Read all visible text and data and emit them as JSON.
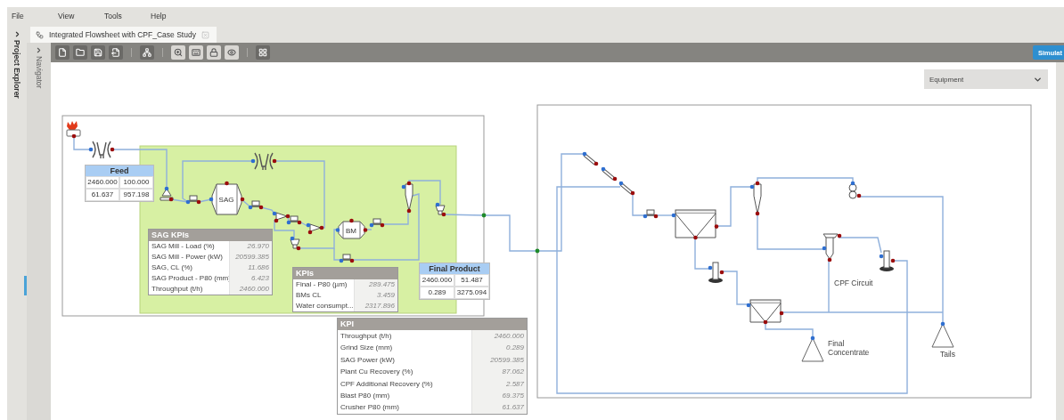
{
  "menu": [
    {
      "label": "File"
    },
    {
      "label": "View"
    },
    {
      "label": "Tools"
    },
    {
      "label": "Help"
    }
  ],
  "sidebar": {
    "label": "Project Explorer"
  },
  "tabs": [
    {
      "label": "Integrated Flowsheet with CPF_Case Study",
      "selected": true
    }
  ],
  "navigator": {
    "label": "Navigator"
  },
  "simulate_button": {
    "label": "Simulat"
  },
  "equipment_dropdown": {
    "value": "Equipment"
  },
  "diagram": {
    "mill_labels": [
      "SAG",
      "BM"
    ],
    "labels": [
      "CPF Circuit",
      "Final Concentrate",
      "Tails"
    ]
  },
  "feed_table": {
    "title": "Feed",
    "rows": [
      [
        "2460.000",
        "100.000"
      ],
      [
        "61.637",
        "957.198"
      ]
    ]
  },
  "sag_kpis": {
    "title": "SAG KPIs",
    "rows": [
      {
        "label": "SAG Mill - Load (%)",
        "value": "26.970"
      },
      {
        "label": "SAG Mill - Power (kW)",
        "value": "20599.385"
      },
      {
        "label": "SAG, CL (%)",
        "value": "11.686"
      },
      {
        "label": "SAG Product - P80 (mm)",
        "value": "6.423"
      },
      {
        "label": "Throughput (t/h)",
        "value": "2460.000"
      }
    ]
  },
  "kpis": {
    "title": "KPIs",
    "rows": [
      {
        "label": "Final - P80 (µm)",
        "value": "289.475"
      },
      {
        "label": "BMs CL",
        "value": "3.459"
      },
      {
        "label": "Water consumpt...",
        "value": "2317.896"
      }
    ]
  },
  "final_product_table": {
    "title": "Final Product",
    "rows": [
      [
        "2460.000",
        "51.487"
      ],
      [
        "0.289",
        "3275.094"
      ]
    ]
  },
  "kpi": {
    "title": "KPI",
    "rows": [
      {
        "label": "Throughput (t/h)",
        "value": "2460.000"
      },
      {
        "label": "Grind Size (mm)",
        "value": "0.289"
      },
      {
        "label": "SAG Power (kW)",
        "value": "20599.385"
      },
      {
        "label": "Plant Cu Recovery (%)",
        "value": "87.062"
      },
      {
        "label": "CPF Additional Recovery (%)",
        "value": "2.587"
      },
      {
        "label": "Blast P80 (mm)",
        "value": "69.375"
      },
      {
        "label": "Crusher P80 (mm)",
        "value": "61.637"
      }
    ]
  }
}
